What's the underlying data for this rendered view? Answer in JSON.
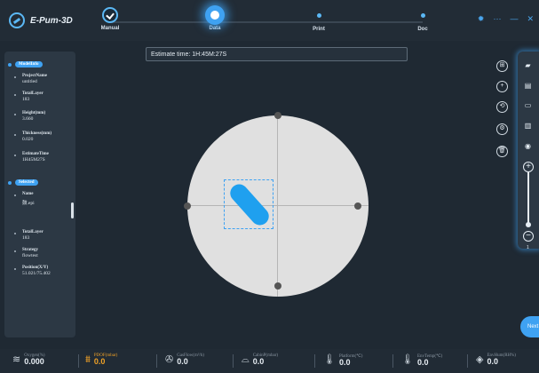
{
  "app": {
    "logo_text": "E-Pum-3D"
  },
  "steps": [
    {
      "label": "Manual",
      "state": "done"
    },
    {
      "label": "Data",
      "state": "active"
    },
    {
      "label": "Print",
      "state": "pending"
    },
    {
      "label": "Doc",
      "state": "pending"
    }
  ],
  "window_controls": {
    "settings": "✹",
    "more": "···",
    "minimize": "—",
    "close": "✕"
  },
  "model_info": {
    "section_label": "ModelInfo",
    "props": [
      {
        "key": "ProjectName",
        "value": "untitled"
      },
      {
        "key": "TotalLayer",
        "value": "183"
      },
      {
        "key": "Height(mm)",
        "value": "3.660"
      },
      {
        "key": "Thickness(mm)",
        "value": "0.020"
      },
      {
        "key": "EstimateTime",
        "value": "1H45M27S"
      }
    ]
  },
  "selected": {
    "section_label": "Selected",
    "props": [
      {
        "key": "Name",
        "value": "鼓.epi"
      },
      {
        "key": "TotalLayer",
        "value": "183"
      },
      {
        "key": "Strategy",
        "value": "flowtest"
      },
      {
        "key": "Position(X/Y)",
        "value": "51.021/75.402"
      }
    ]
  },
  "estimate_bar": {
    "text": "Estimate time: 1H:45M:27S"
  },
  "right_panel": {
    "zoom_level": "1"
  },
  "next_button": {
    "label": "Next"
  },
  "status": [
    {
      "label": "Oxygen(%)",
      "value": "0.000",
      "icon": "oxygen-icon",
      "highlight": false
    },
    {
      "label": "PDOF(mbar)",
      "value": "0.0",
      "icon": "pressure-icon",
      "highlight": true
    },
    {
      "label": "GasFlow(m³/h)",
      "value": "0.0",
      "icon": "fan-icon",
      "highlight": false
    },
    {
      "label": "CabinP(mbar)",
      "value": "0.0",
      "icon": "gauge-icon",
      "highlight": false
    },
    {
      "label": "Platform(℃)",
      "value": "0.0",
      "icon": "thermometer-icon",
      "highlight": false
    },
    {
      "label": "EnvTemp(℃)",
      "value": "0.0",
      "icon": "thermometer-icon",
      "highlight": false
    },
    {
      "label": "EnvHum(RH%)",
      "value": "0.0",
      "icon": "humidity-icon",
      "highlight": false
    }
  ],
  "colors": {
    "accent": "#3fa2f2",
    "highlight": "#f1a227",
    "background": "#1f2933"
  }
}
